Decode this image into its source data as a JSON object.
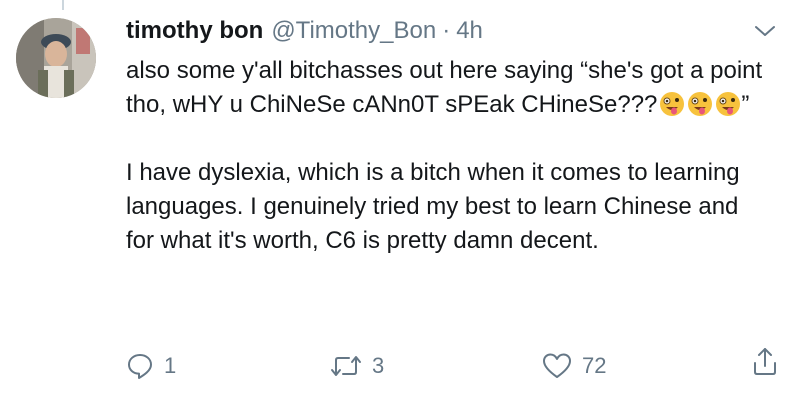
{
  "tweet": {
    "display_name": "timothy bon",
    "handle": "@Timothy_Bon",
    "separator": "·",
    "time": "4h",
    "text_part1": "also some y'all bitchasses out here saying “she's got a point tho, wHY u ChiNeSe cANn0T sPEak CHineSe???",
    "text_part1_end": "”",
    "text_part2": "I have dyslexia, which is a bitch when it comes to learning languages. I genuinely tried my best to learn Chinese and for what it's worth, C6 is pretty damn decent.",
    "emojis": [
      "zany-face-icon",
      "zany-face-icon",
      "zany-face-icon"
    ]
  },
  "actions": {
    "reply_count": "1",
    "retweet_count": "3",
    "like_count": "72"
  },
  "icons": {
    "reply": "reply-icon",
    "retweet": "retweet-icon",
    "like": "heart-icon",
    "share": "share-icon",
    "menu": "chevron-down-icon"
  },
  "colors": {
    "text": "#14171a",
    "secondary": "#657786",
    "emoji_face": "#f7c23d"
  }
}
